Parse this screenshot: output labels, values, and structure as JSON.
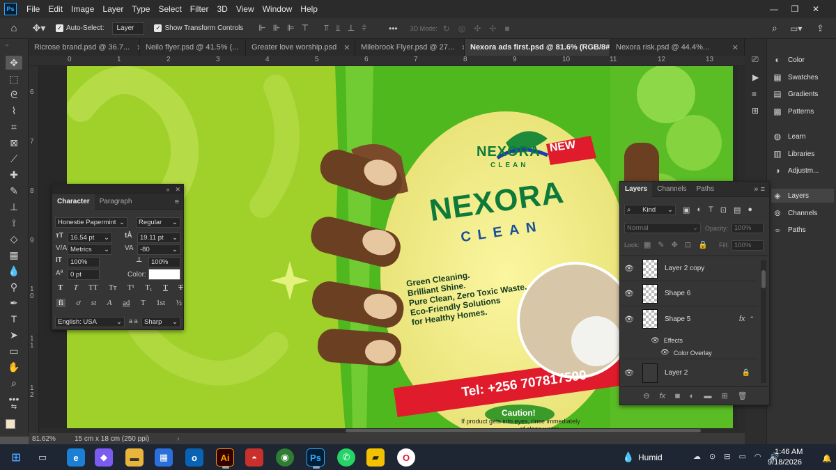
{
  "app": {
    "logo": "Ps"
  },
  "menu": [
    "File",
    "Edit",
    "Image",
    "Layer",
    "Type",
    "Select",
    "Filter",
    "3D",
    "View",
    "Window",
    "Help"
  ],
  "options_bar": {
    "auto_select_label": "Auto-Select:",
    "auto_select_value": "Layer",
    "transform_label": "Show Transform Controls",
    "mode_3d": "3D Mode:",
    "more": "•••"
  },
  "tabs": [
    {
      "label": "Ricrose brand.psd @ 36.7..."
    },
    {
      "label": "Neilo flyer.psd @ 41.5% (..."
    },
    {
      "label": "Greater love worship.psd"
    },
    {
      "label": "Milebrook Flyer.psd @ 27..."
    },
    {
      "label": "Nexora ads first.psd @ 81.6% (RGB/8#)"
    },
    {
      "label": "Nexora risk.psd @ 44.4%..."
    }
  ],
  "ruler_top": [
    "0",
    "1",
    "2",
    "3",
    "4",
    "5",
    "6",
    "7",
    "8",
    "9",
    "10",
    "11",
    "12",
    "13"
  ],
  "ruler_left": [
    "6",
    "7",
    "8",
    "9",
    "1 0",
    "1 1",
    "1 2"
  ],
  "artwork": {
    "brand": "NEXORA",
    "brand_sub": "CLEAN",
    "badge": "NEW",
    "title": "NEXORA",
    "subtitle": "CLEAN",
    "bullets": [
      "Green Cleaning.",
      "Brilliant Shine.",
      "Pure Clean, Zero Toxic Waste.",
      "Eco-Friendly Solutions",
      "for Healthy Homes."
    ],
    "phone": "Tel: +256 707817590",
    "caution": "Caution!",
    "caution_text": "If product gets into eyes, rinse immediately",
    "caution_text2": "of clean water."
  },
  "status": {
    "zoom": "81.62%",
    "doc": "15 cm x 18 cm (250 ppi)"
  },
  "character_panel": {
    "tabs": [
      "Character",
      "Paragraph"
    ],
    "font": "Honestie Papermint",
    "style": "Regular",
    "size": "16.54 pt",
    "leading": "19.11 pt",
    "kerning": "Metrics",
    "tracking": "-80",
    "vscale": "100%",
    "hscale": "100%",
    "baseline": "0 pt",
    "color_label": "Color:",
    "color": "#ffffff",
    "language": "English: USA",
    "aa": "Sharp",
    "aa_label": "a a",
    "type_buttons": [
      "T",
      "T",
      "TT",
      "Tт",
      "T¹",
      "T₁",
      "T",
      "T"
    ],
    "ot_buttons": [
      "fi",
      "ơ",
      "st",
      "A",
      "ad",
      "T",
      "1st",
      "½"
    ]
  },
  "dock": {
    "items_top": [
      "Color",
      "Swatches",
      "Gradients",
      "Patterns"
    ],
    "items_mid": [
      "Learn",
      "Libraries",
      "Adjustm..."
    ],
    "items_bot": [
      "Layers",
      "Channels",
      "Paths"
    ]
  },
  "layers_panel": {
    "tabs": [
      "Layers",
      "Channels",
      "Paths"
    ],
    "filter": "Kind",
    "blend": "Normal",
    "opacity_label": "Opacity:",
    "opacity": "100%",
    "lock_label": "Lock:",
    "fill_label": "Fill:",
    "fill": "100%",
    "layers": [
      {
        "name": "Layer 2 copy"
      },
      {
        "name": "Shape 6"
      },
      {
        "name": "Shape 5",
        "fx": "fx"
      },
      {
        "name": "Effects",
        "sub": true
      },
      {
        "name": "Color Overlay",
        "sub": true
      },
      {
        "name": "Layer 2"
      }
    ]
  },
  "taskbar": {
    "weather": "Humid",
    "time": "1:46 AM",
    "date": "9/18/2026"
  },
  "colors": {
    "accent": "#31a8ff",
    "brand_green": "#0e7a3a",
    "phone_red": "#e01b2c"
  }
}
